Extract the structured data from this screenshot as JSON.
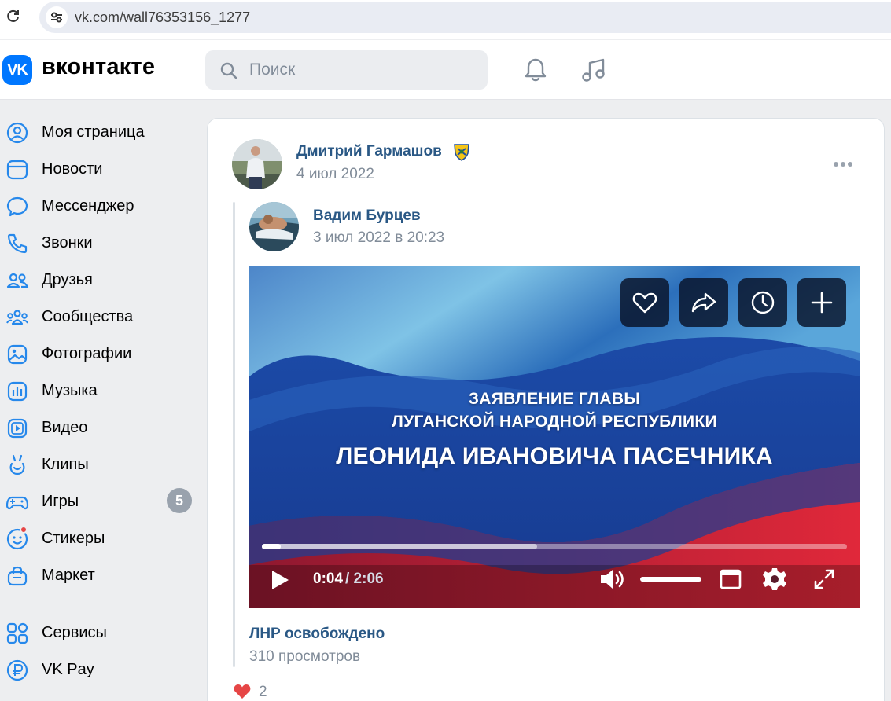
{
  "browser": {
    "url": "vk.com/wall76353156_1277"
  },
  "header": {
    "logo_text": "VK",
    "wordmark": "вконтакте",
    "search_placeholder": "Поиск"
  },
  "sidebar": {
    "items": [
      {
        "label": "Моя страница",
        "icon": "user-circle-icon"
      },
      {
        "label": "Новости",
        "icon": "news-icon"
      },
      {
        "label": "Мессенджер",
        "icon": "message-icon"
      },
      {
        "label": "Звонки",
        "icon": "phone-icon"
      },
      {
        "label": "Друзья",
        "icon": "friends-icon"
      },
      {
        "label": "Сообщества",
        "icon": "communities-icon"
      },
      {
        "label": "Фотографии",
        "icon": "photo-icon"
      },
      {
        "label": "Музыка",
        "icon": "music-icon"
      },
      {
        "label": "Видео",
        "icon": "video-icon"
      },
      {
        "label": "Клипы",
        "icon": "clips-icon"
      },
      {
        "label": "Игры",
        "icon": "gamepad-icon",
        "badge": "5"
      },
      {
        "label": "Стикеры",
        "icon": "stickers-icon"
      },
      {
        "label": "Маркет",
        "icon": "market-icon"
      }
    ],
    "secondary": [
      {
        "label": "Сервисы",
        "icon": "services-icon"
      },
      {
        "label": "VK Pay",
        "icon": "vkpay-icon"
      }
    ]
  },
  "post": {
    "author": "Дмитрий Гармашов",
    "date": "4 июл 2022",
    "repost": {
      "author": "Вадим Бурцев",
      "date": "3 июл 2022 в 20:23"
    },
    "video": {
      "line1": "ЗАЯВЛЕНИЕ ГЛАВЫ",
      "line2": "ЛУГАНСКОЙ НАРОДНОЙ РЕСПУБЛИКИ",
      "line3": "ЛЕОНИДА ИВАНОВИЧА ПАСЕЧНИКА",
      "time_current": "0:04",
      "time_total": "/ 2:06",
      "played_fraction": 0.032,
      "buffered_fraction": 0.47,
      "title": "ЛНР освобождено",
      "views": "310 просмотров"
    },
    "likes": "2"
  },
  "colors": {
    "accent": "#0077ff",
    "link": "#2a5885",
    "muted": "#818c99",
    "badge": "#99a2ad"
  }
}
